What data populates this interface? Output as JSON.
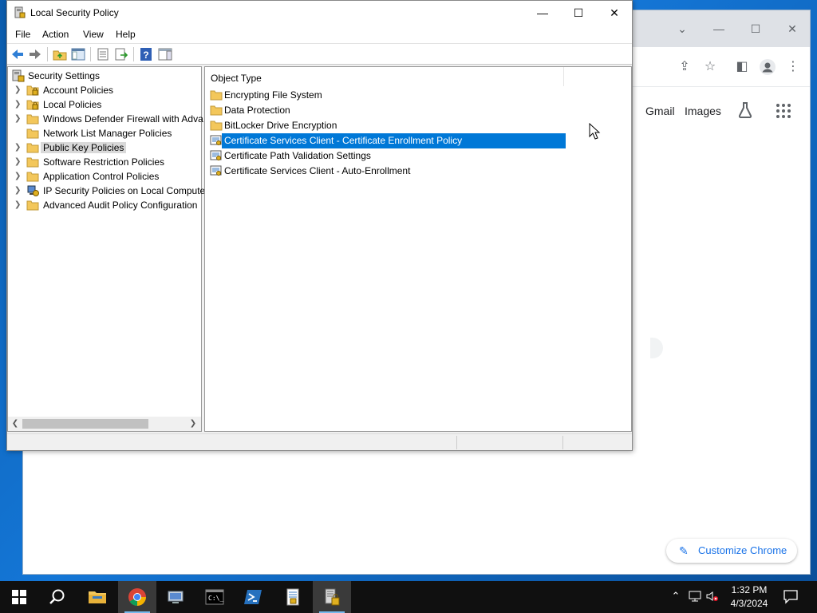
{
  "window": {
    "title": "Local Security Policy",
    "controls": {
      "minimize": "—",
      "maximize": "☐",
      "close": "✕"
    }
  },
  "menu": [
    "File",
    "Action",
    "View",
    "Help"
  ],
  "tree": {
    "root": "Security Settings",
    "items": [
      {
        "label": "Account Policies",
        "expandable": true,
        "icon": "folder-lock-icon"
      },
      {
        "label": "Local Policies",
        "expandable": true,
        "icon": "folder-lock-icon"
      },
      {
        "label": "Windows Defender Firewall with Adva",
        "expandable": true,
        "icon": "folder-icon"
      },
      {
        "label": "Network List Manager Policies",
        "expandable": false,
        "icon": "folder-icon"
      },
      {
        "label": "Public Key Policies",
        "expandable": true,
        "icon": "folder-icon",
        "selected": true
      },
      {
        "label": "Software Restriction Policies",
        "expandable": true,
        "icon": "folder-icon"
      },
      {
        "label": "Application Control Policies",
        "expandable": true,
        "icon": "folder-icon"
      },
      {
        "label": "IP Security Policies on Local Compute",
        "expandable": true,
        "icon": "ip-security-icon"
      },
      {
        "label": "Advanced Audit Policy Configuration",
        "expandable": true,
        "icon": "folder-icon"
      }
    ]
  },
  "list": {
    "column": "Object Type",
    "items": [
      {
        "label": "Encrypting File System",
        "icon": "folder-icon"
      },
      {
        "label": "Data Protection",
        "icon": "folder-icon"
      },
      {
        "label": "BitLocker Drive Encryption",
        "icon": "folder-icon"
      },
      {
        "label": "Certificate Services Client - Certificate Enrollment Policy",
        "icon": "certificate-icon",
        "selected": true
      },
      {
        "label": "Certificate Path Validation Settings",
        "icon": "certificate-icon"
      },
      {
        "label": "Certificate Services Client - Auto-Enrollment",
        "icon": "certificate-icon"
      }
    ]
  },
  "chrome": {
    "links": [
      "Gmail",
      "Images"
    ],
    "customize": "Customize Chrome"
  },
  "taskbar": {
    "time": "1:32 PM",
    "date": "4/3/2024"
  },
  "colors": {
    "selection": "#0078d7",
    "folder": "#f3c75b",
    "desktop": "#0b5cad"
  }
}
